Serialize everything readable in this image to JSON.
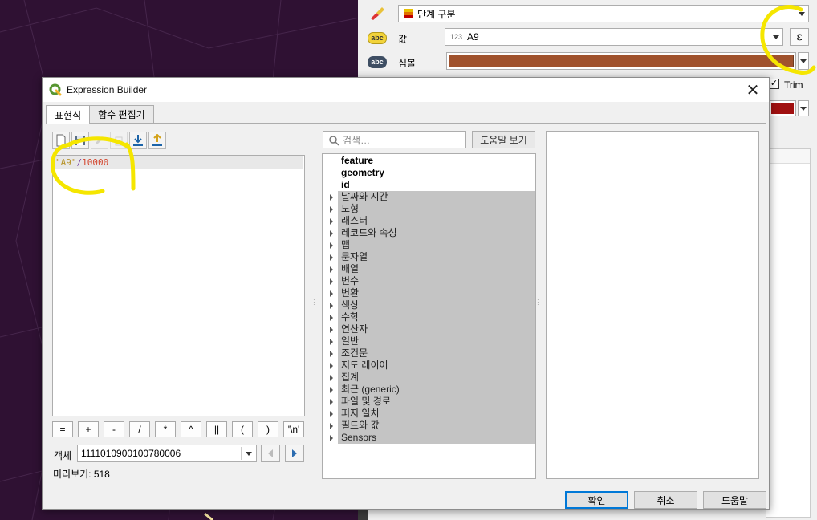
{
  "style_panel": {
    "renderer_combo": "단계 구분",
    "value_label": "값",
    "value_field": "A9",
    "value_field_type": "123",
    "symbol_label": "심볼",
    "symbol_color": "#a0522d",
    "trim_label": "Trim",
    "trim_checked": true,
    "ramp_color": "#a01010",
    "expression_button": "ε"
  },
  "dialog": {
    "title": "Expression Builder",
    "tabs": [
      {
        "label": "표현식",
        "active": true
      },
      {
        "label": "함수 편집기",
        "active": false
      }
    ],
    "expression": {
      "string": "\"A9\"",
      "operator": "/",
      "number": "10000"
    },
    "operators": [
      "=",
      "+",
      "-",
      "/",
      "*",
      "^",
      "||",
      "(",
      ")",
      "'\\n'"
    ],
    "feature_label": "객체",
    "feature_value": "1111010900100780006",
    "preview": "미리보기: 518",
    "search_placeholder": "검색…",
    "show_help_button": "도움말 보기",
    "tree_fields": [
      "feature",
      "geometry",
      "id"
    ],
    "tree_groups": [
      "날짜와 시간",
      "도형",
      "래스터",
      "레코드와 속성",
      "맵",
      "문자열",
      "배열",
      "변수",
      "변환",
      "색상",
      "수학",
      "연산자",
      "일반",
      "조건문",
      "지도 레이어",
      "집계",
      "최근 (generic)",
      "파일 및 경로",
      "퍼지 일치",
      "필드와 값",
      "Sensors"
    ],
    "buttons": {
      "ok": "확인",
      "cancel": "취소",
      "help": "도움말"
    }
  },
  "colors": {
    "annotation": "#f5e600",
    "map_bg": "#2f1133"
  },
  "icons": [
    "qgis-logo-icon",
    "close-icon",
    "new-file-icon",
    "save-icon",
    "edit-icon",
    "delete-icon",
    "import-icon",
    "export-icon",
    "search-icon",
    "brush-icon",
    "epsilon-icon"
  ]
}
